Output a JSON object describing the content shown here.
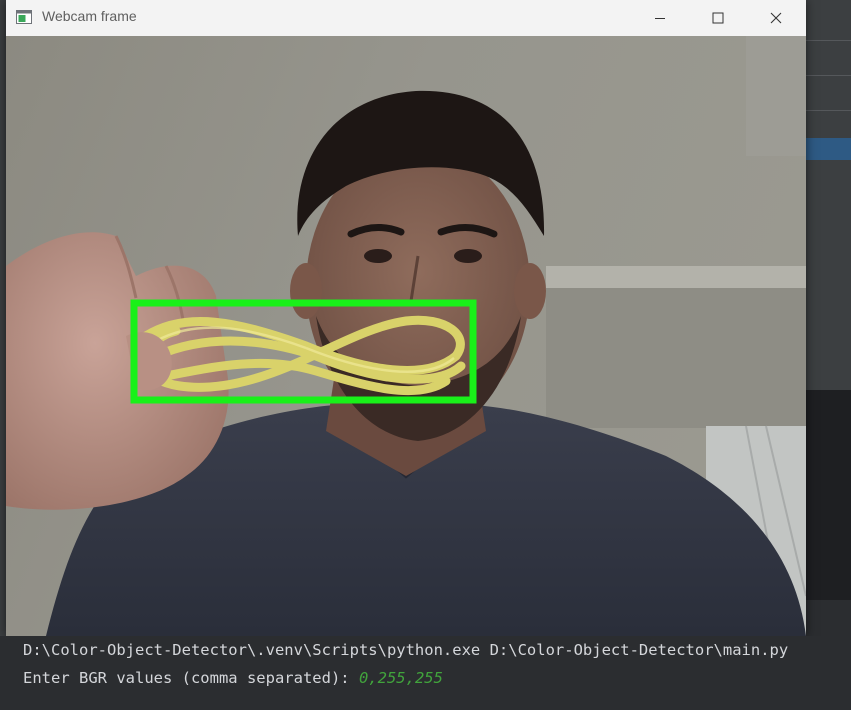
{
  "window": {
    "title": "Webcam frame",
    "controls": {
      "minimize": "minimize-icon",
      "maximize": "maximize-icon",
      "close": "close-icon"
    }
  },
  "webcam": {
    "detection_box_color": "#19f019",
    "object_color": "#d9d26a"
  },
  "terminal": {
    "command": "D:\\Color-Object-Detector\\.venv\\Scripts\\python.exe D:\\Color-Object-Detector\\main.py",
    "prompt": "Enter BGR values (comma separated): ",
    "input": "0,255,255",
    "input_color": "#41a33c"
  }
}
